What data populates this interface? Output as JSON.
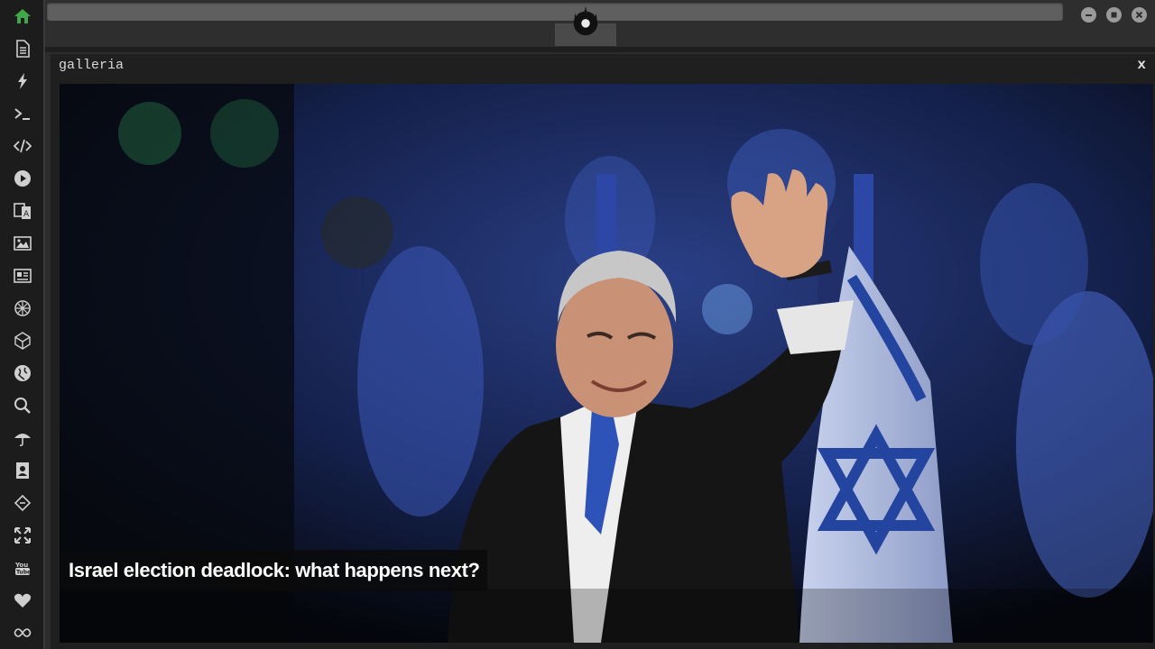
{
  "sidebar": {
    "items": [
      {
        "name": "home-icon",
        "active": true
      },
      {
        "name": "document-icon"
      },
      {
        "name": "lightning-icon"
      },
      {
        "name": "terminal-icon"
      },
      {
        "name": "code-icon"
      },
      {
        "name": "play-icon"
      },
      {
        "name": "translate-icon"
      },
      {
        "name": "image-icon"
      },
      {
        "name": "newspaper-icon"
      },
      {
        "name": "rebel-icon"
      },
      {
        "name": "polyhedron-icon"
      },
      {
        "name": "globe-icon"
      },
      {
        "name": "search-icon"
      },
      {
        "name": "umbrella-icon"
      },
      {
        "name": "contact-book-icon"
      },
      {
        "name": "diamond-code-icon"
      },
      {
        "name": "expand-icon"
      },
      {
        "name": "youtube-icon"
      },
      {
        "name": "heart-icon"
      },
      {
        "name": "infinity-icon"
      }
    ],
    "accent_color": "#3fa84a"
  },
  "window": {
    "controls": [
      "minimize",
      "maximize",
      "close"
    ]
  },
  "panel": {
    "title": "galleria",
    "close_label": "x"
  },
  "gallery": {
    "caption": "Israel election deadlock: what happens next?",
    "image_description_colors": {
      "flag_blue": "#1c3b9e",
      "suit": "#141414"
    }
  }
}
